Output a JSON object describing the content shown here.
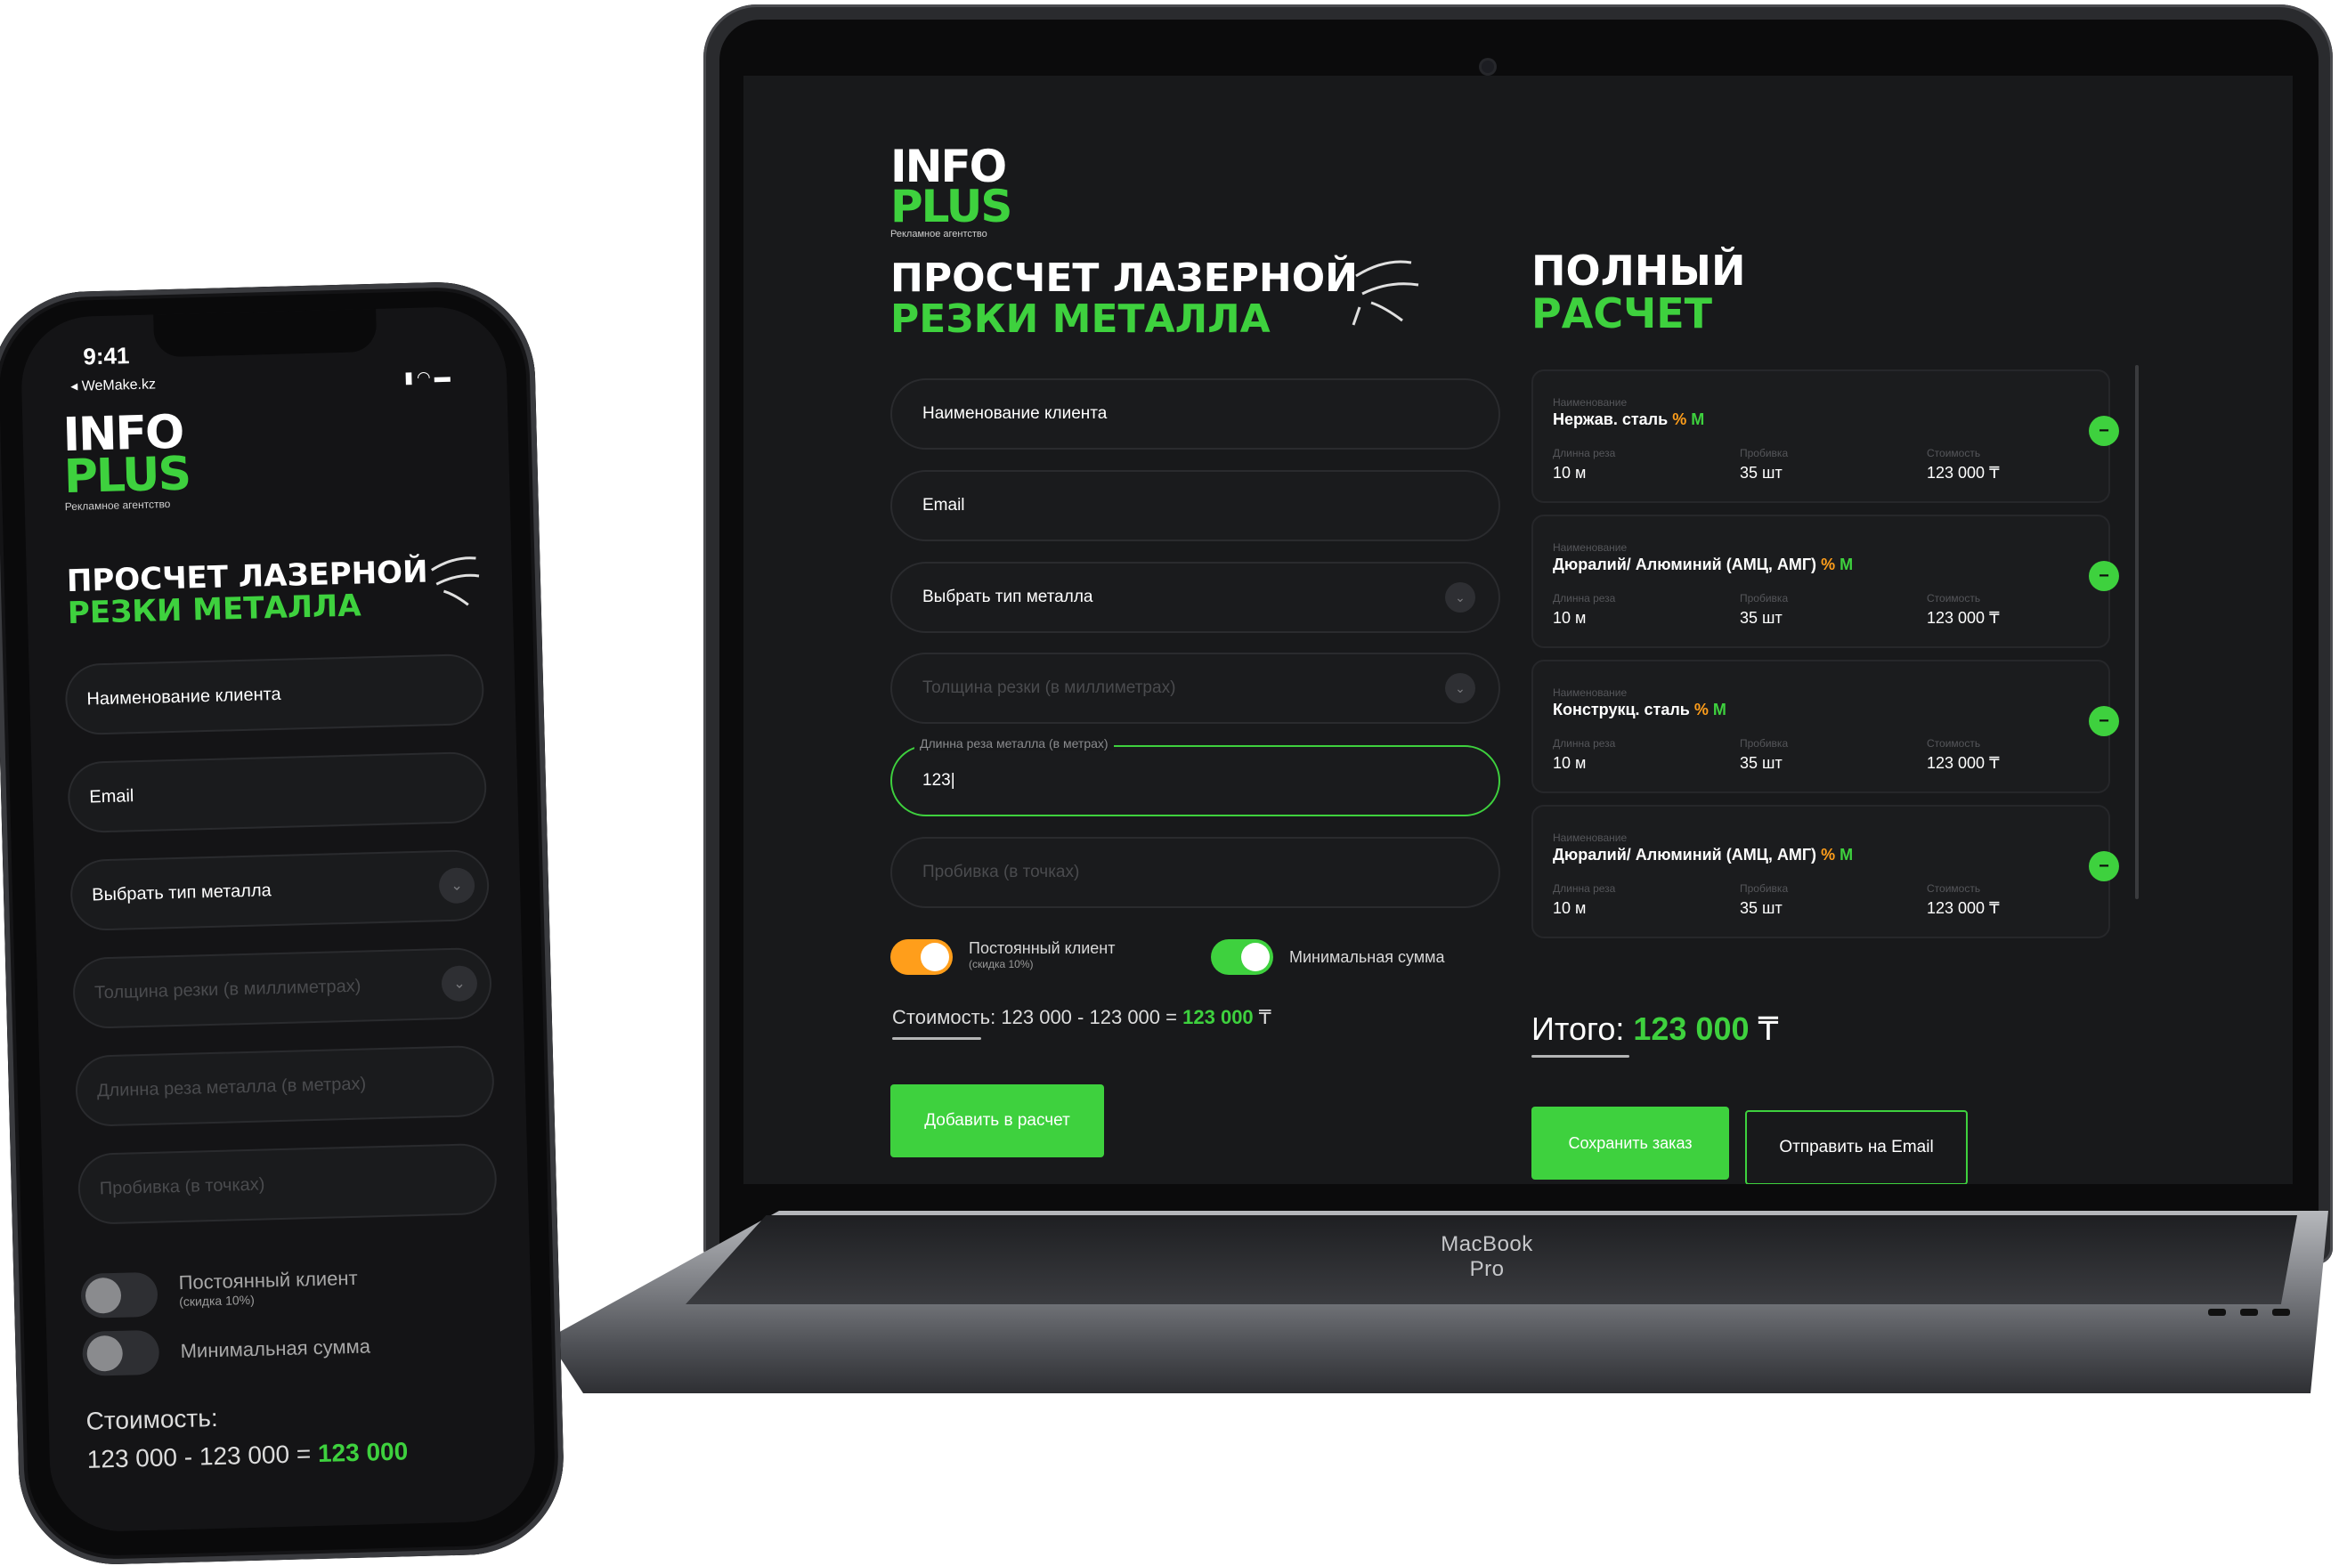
{
  "laptop": {
    "brand": "MacBook Pro",
    "logo": {
      "line1": "INFO",
      "line2": "PLUS",
      "subtitle": "Рекламное агентство"
    },
    "title": {
      "line1": "ПРОСЧЕТ ЛАЗЕРНОЙ",
      "line2": "РЕЗКИ МЕТАЛЛА"
    },
    "form": {
      "client_name": "Наименование клиента",
      "email": "Email",
      "metal_type": "Выбрать тип металла",
      "thickness": "Толщина резки (в миллиметрах)",
      "length_label": "Длинна реза металла (в метрах)",
      "length_value": "123|",
      "piercing": "Пробивка (в точках)"
    },
    "toggles": {
      "regular_client": "Постоянный клиент",
      "regular_client_note": "(скидка 10%)",
      "min_sum": "Минимальная сумма"
    },
    "cost": {
      "label": "Стоимость:",
      "a": "123 000",
      "minus": "-",
      "b": "123 000",
      "equals": "=",
      "result": "123 000",
      "currency": "₸"
    },
    "add_button": "Добавить в расчет",
    "summary_title": {
      "line1": "ПОЛНЫЙ",
      "line2": "РАСЧЕТ"
    },
    "field_labels": {
      "name": "Наименование",
      "length": "Длинна реза",
      "piercing": "Пробивка",
      "cost": "Стоимость"
    },
    "orders": [
      {
        "name": "Нержав. сталь",
        "pct": "%",
        "unit": "M",
        "length": "10 м",
        "piercing": "35 шт",
        "cost": "123 000 ₸"
      },
      {
        "name": "Дюралий/ Алюминий  (АМЦ, АМГ)",
        "pct": "%",
        "unit": "M",
        "length": "10 м",
        "piercing": "35 шт",
        "cost": "123 000 ₸"
      },
      {
        "name": "Конструкц. сталь",
        "pct": "%",
        "unit": "M",
        "length": "10 м",
        "piercing": "35 шт",
        "cost": "123 000 ₸"
      },
      {
        "name": "Дюралий/ Алюминий  (АМЦ, АМГ)",
        "pct": "%",
        "unit": "M",
        "length": "10 м",
        "piercing": "35 шт",
        "cost": "123 000 ₸"
      }
    ],
    "total": {
      "label": "Итого:",
      "value": "123 000",
      "currency": "₸"
    },
    "save_button": "Сохранить заказ",
    "email_button": "Отправить на Email"
  },
  "phone": {
    "time": "9:41",
    "carrier": "◂ WeMake.kz",
    "logo": {
      "line1": "INFO",
      "line2": "PLUS",
      "subtitle": "Рекламное агентство"
    },
    "title": {
      "line1": "ПРОСЧЕТ ЛАЗЕРНОЙ",
      "line2": "РЕЗКИ МЕТАЛЛА"
    },
    "form": {
      "client_name": "Наименование клиента",
      "email": "Email",
      "metal_type": "Выбрать тип металла",
      "thickness": "Толщина резки (в миллиметрах)",
      "length": "Длинна реза металла (в метрах)",
      "piercing": "Пробивка (в точках)"
    },
    "toggles": {
      "regular_client": "Постоянный клиент",
      "regular_client_note": "(скидка 10%)",
      "min_sum": "Минимальная сумма"
    },
    "cost": {
      "label": "Стоимость:",
      "a": "123 000",
      "minus": "-",
      "b": "123 000",
      "equals": "=",
      "result": "123 000"
    }
  },
  "colors": {
    "accent": "#3ed13e",
    "warning": "#ff9e1b",
    "background": "#18191b"
  },
  "icons": {
    "chevron": "chevron-down-icon",
    "minus": "minus-icon"
  }
}
